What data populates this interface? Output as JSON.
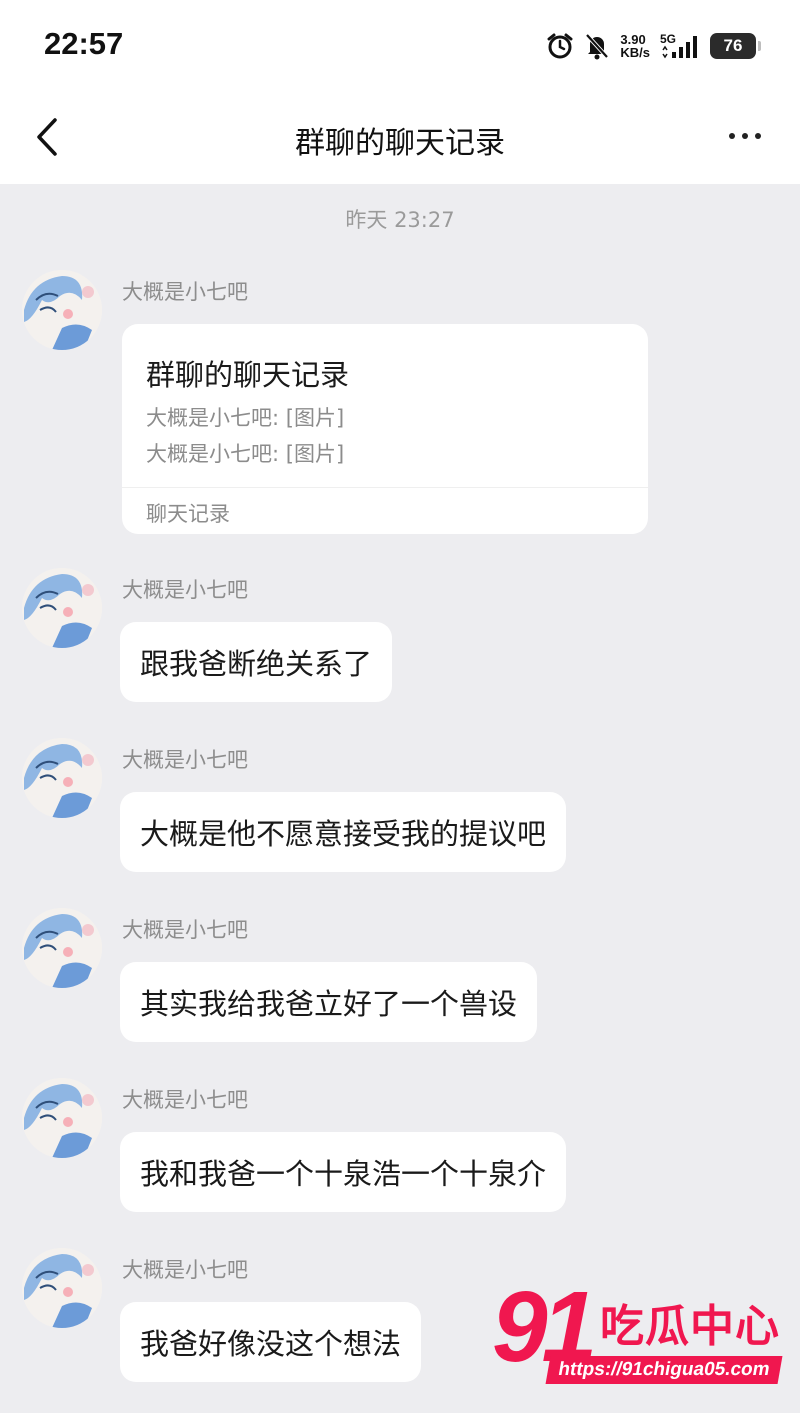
{
  "status_bar": {
    "time": "22:57",
    "speed_value": "3.90",
    "speed_unit": "KB/s",
    "network": "5G",
    "battery": "76",
    "icons": [
      "alarm-icon",
      "bell-muted-icon",
      "signal-icon",
      "battery-icon"
    ]
  },
  "nav": {
    "title": "群聊的聊天记录",
    "back_icon": "chevron-left-icon",
    "more_icon": "more-icon"
  },
  "chat": {
    "timestamp": "昨天 23:27",
    "forward_card": {
      "sender": "大概是小七吧",
      "title": "群聊的聊天记录",
      "lines": [
        "大概是小七吧: [图片]",
        "大概是小七吧: [图片]"
      ],
      "footer": "聊天记录"
    },
    "messages": [
      {
        "sender": "大概是小七吧",
        "text": "跟我爸断绝关系了"
      },
      {
        "sender": "大概是小七吧",
        "text": "大概是他不愿意接受我的提议吧"
      },
      {
        "sender": "大概是小七吧",
        "text": "其实我给我爸立好了一个兽设"
      },
      {
        "sender": "大概是小七吧",
        "text": "我和我爸一个十泉浩一个十泉介"
      },
      {
        "sender": "大概是小七吧",
        "text": "我爸好像没这个想法"
      }
    ]
  },
  "watermark": {
    "number": "91",
    "name": "吃瓜中心",
    "url": "https://91chigua05.com"
  },
  "colors": {
    "background": "#ededf0",
    "bubble": "#ffffff",
    "secondary_text": "#8d8d8d",
    "watermark": "#f0174f"
  }
}
